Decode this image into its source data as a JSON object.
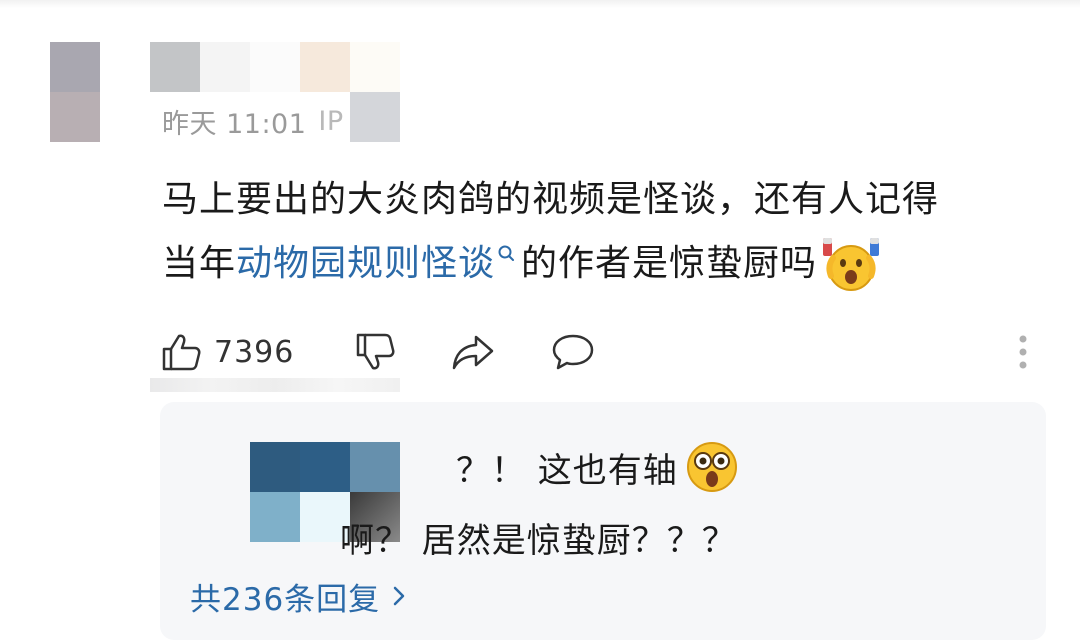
{
  "comment": {
    "meta": {
      "time": "昨天 11:01",
      "ip_prefix": "IP"
    },
    "body_part1": "马上要出的大炎肉鸽的视频是怪谈，还有人记得",
    "body_part2_prefix": "当年",
    "body_link": "动物园规则怪谈",
    "body_part2_suffix": "的作者是惊蛰厨吗",
    "emoji": "shocked-face-emoji",
    "likes": "7396"
  },
  "actions": {
    "like_icon": "thumbs-up-icon",
    "dislike_icon": "thumbs-down-icon",
    "share_icon": "share-icon",
    "reply_icon": "comment-bubble-icon",
    "more_icon": "vertical-dots-icon"
  },
  "replies": {
    "reply1_text": "？！ 这也有轴",
    "reply1_emoji": "surprised-face-emoji",
    "reply2_text": "啊？ 居然是惊蛰厨？？？",
    "see_all": "共236条回复"
  },
  "colors": {
    "link": "#2b6aa8",
    "meta": "#9a9a9a",
    "reply_bg": "#f6f7f9"
  }
}
